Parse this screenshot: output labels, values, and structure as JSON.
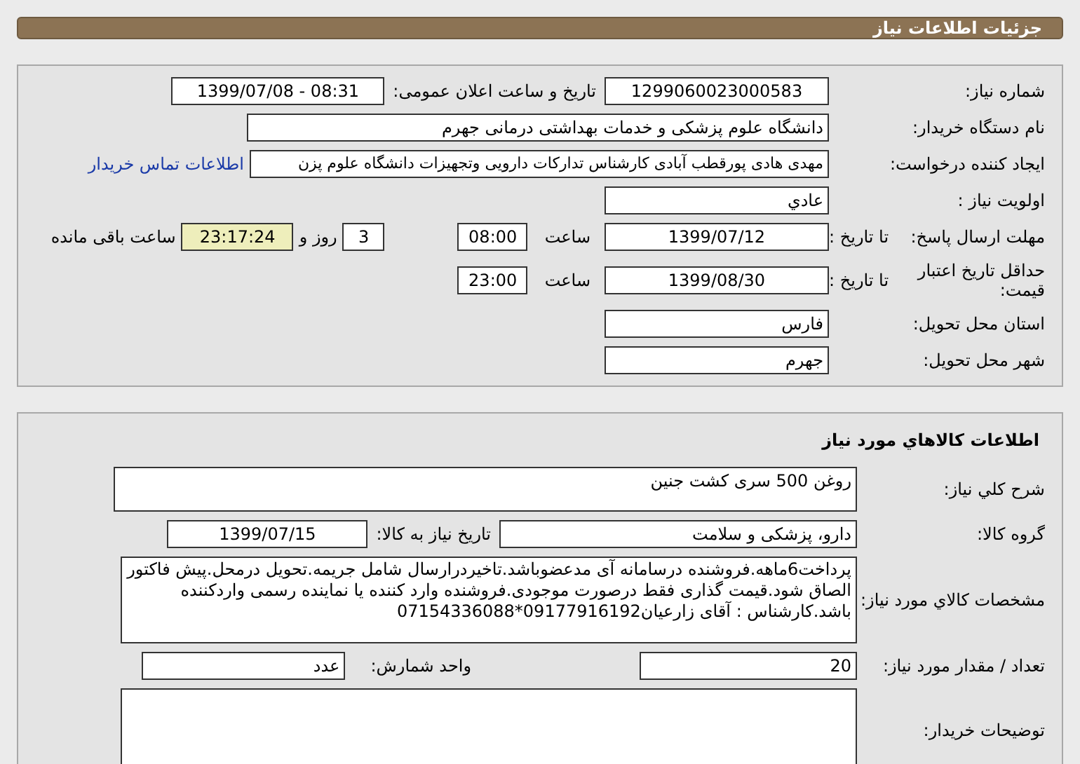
{
  "header": {
    "title": "جزئیات اطلاعات نیاز"
  },
  "need_info": {
    "need_number": {
      "label": "شماره نیاز:",
      "value": "1299060023000583"
    },
    "announce": {
      "label": "تاریخ و ساعت اعلان عمومی:",
      "value": "1399/07/08 - 08:31"
    },
    "buyer_org": {
      "label": "نام دستگاه خریدار:",
      "value": "دانشگاه علوم پزشکی و خدمات بهداشتی درمانی جهرم"
    },
    "requester": {
      "label": "ایجاد کننده درخواست:",
      "value": "مهدی هادی پورقطب آبادی کارشناس تدارکات دارویی وتجهیزات دانشگاه علوم پزن",
      "link": "اطلاعات تماس خریدار"
    },
    "priority": {
      "label": "اولویت نیاز :",
      "value": "عادي"
    },
    "response_deadline": {
      "label": "مهلت ارسال پاسخ:",
      "sublabel": "تا تاریخ :",
      "date": "1399/07/12",
      "time_label": "ساعت",
      "time": "08:00",
      "days": "3",
      "days_label": "روز و",
      "remaining": "23:17:24",
      "remaining_label": "ساعت باقی مانده"
    },
    "price_validity": {
      "label": "حداقل تاریخ اعتبار قیمت:",
      "sublabel": "تا تاریخ :",
      "date": "1399/08/30",
      "time_label": "ساعت",
      "time": "23:00"
    },
    "province": {
      "label": "استان محل تحویل:",
      "value": "فارس"
    },
    "city": {
      "label": "شهر محل تحویل:",
      "value": "جهرم"
    }
  },
  "goods": {
    "title": "اطلاعات کالاهاي مورد نیاز",
    "summary": {
      "label": "شرح کلي نیاز:",
      "value": "روغن 500 سری کشت جنین"
    },
    "group": {
      "label": "گروه کالا:",
      "value": "دارو، پزشکی و سلامت"
    },
    "need_date": {
      "label": "تاریخ نیاز به کالا:",
      "value": "1399/07/15"
    },
    "specs": {
      "label": "مشخصات کالاي مورد نیاز:",
      "value": "پرداخت6ماهه.فروشنده درسامانه آی مدعضوباشد.تاخیردرارسال شامل جریمه.تحویل درمحل.پیش فاکتور الصاق شود.قیمت گذاری فقط درصورت موجودی.فروشنده وارد کننده یا نماینده رسمی واردکننده باشد.کارشناس : آقای زارعیان09177916192*07154336088"
    },
    "quantity": {
      "label": "تعداد / مقدار مورد نیاز:",
      "value": "20"
    },
    "unit": {
      "label": "واحد شمارش:",
      "value": "عدد"
    },
    "buyer_notes": {
      "label": "توضیحات خریدار:"
    }
  }
}
